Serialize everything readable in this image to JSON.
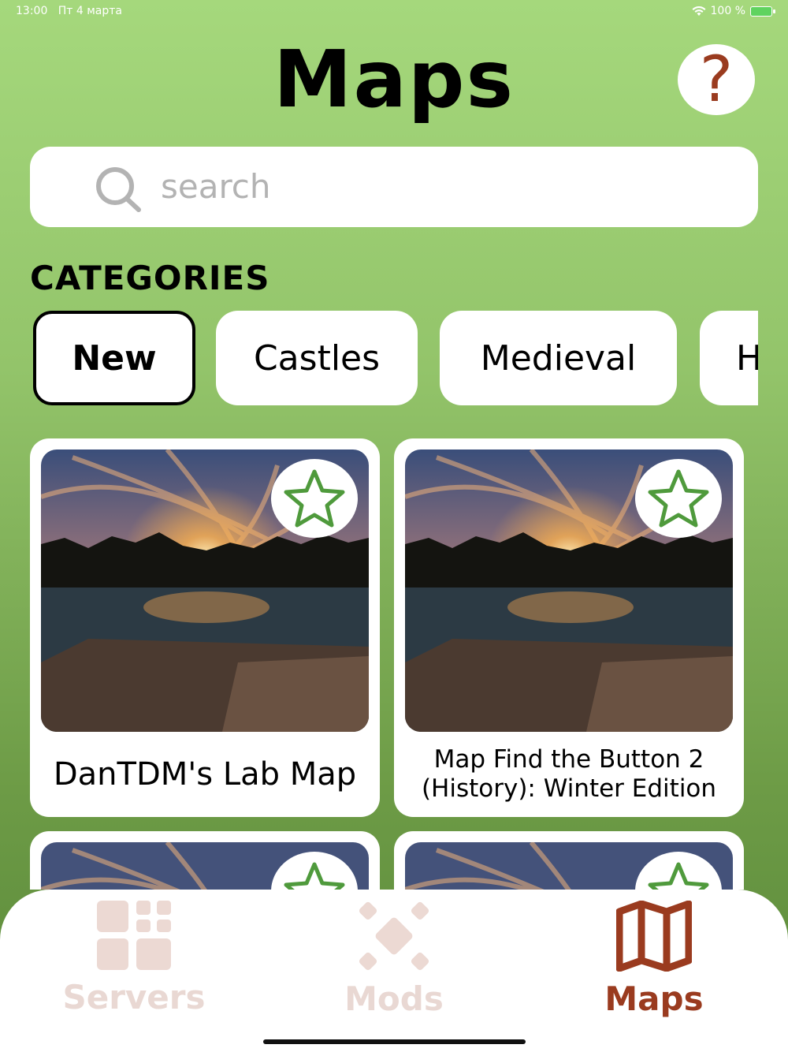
{
  "status_bar": {
    "time": "13:00",
    "date": "Пт 4 марта",
    "battery": "100 %"
  },
  "header": {
    "title": "Maps",
    "help_icon": "question-mark-icon",
    "help_label": "?"
  },
  "search": {
    "placeholder": "search",
    "value": "",
    "icon": "search-icon"
  },
  "categories": {
    "title": "CATEGORIES",
    "items": [
      {
        "label": "New",
        "active": true
      },
      {
        "label": "Castles",
        "active": false
      },
      {
        "label": "Medieval",
        "active": false
      },
      {
        "label": "H",
        "active": false
      }
    ]
  },
  "maps": [
    {
      "title": "DanTDM's Lab Map",
      "favorite": false,
      "favorite_icon": "star-outline-icon"
    },
    {
      "title": "Map Find the Button 2 (History): Winter Edition",
      "favorite": false,
      "favorite_icon": "star-outline-icon"
    },
    {
      "title": "",
      "favorite": false,
      "favorite_icon": "star-outline-icon"
    },
    {
      "title": "",
      "favorite": false,
      "favorite_icon": "star-outline-icon"
    }
  ],
  "tabbar": {
    "items": [
      {
        "label": "Servers",
        "icon": "grid-icon",
        "active": false
      },
      {
        "label": "Mods",
        "icon": "diamond-blocks-icon",
        "active": false
      },
      {
        "label": "Maps",
        "icon": "map-icon",
        "active": true
      }
    ]
  },
  "colors": {
    "accent": "#9a3b1f",
    "inactive_tab": "#e9d8d3",
    "background_top": "#a5d87c",
    "background_bottom": "#5b8a3a",
    "star": "#4f9a3c"
  }
}
